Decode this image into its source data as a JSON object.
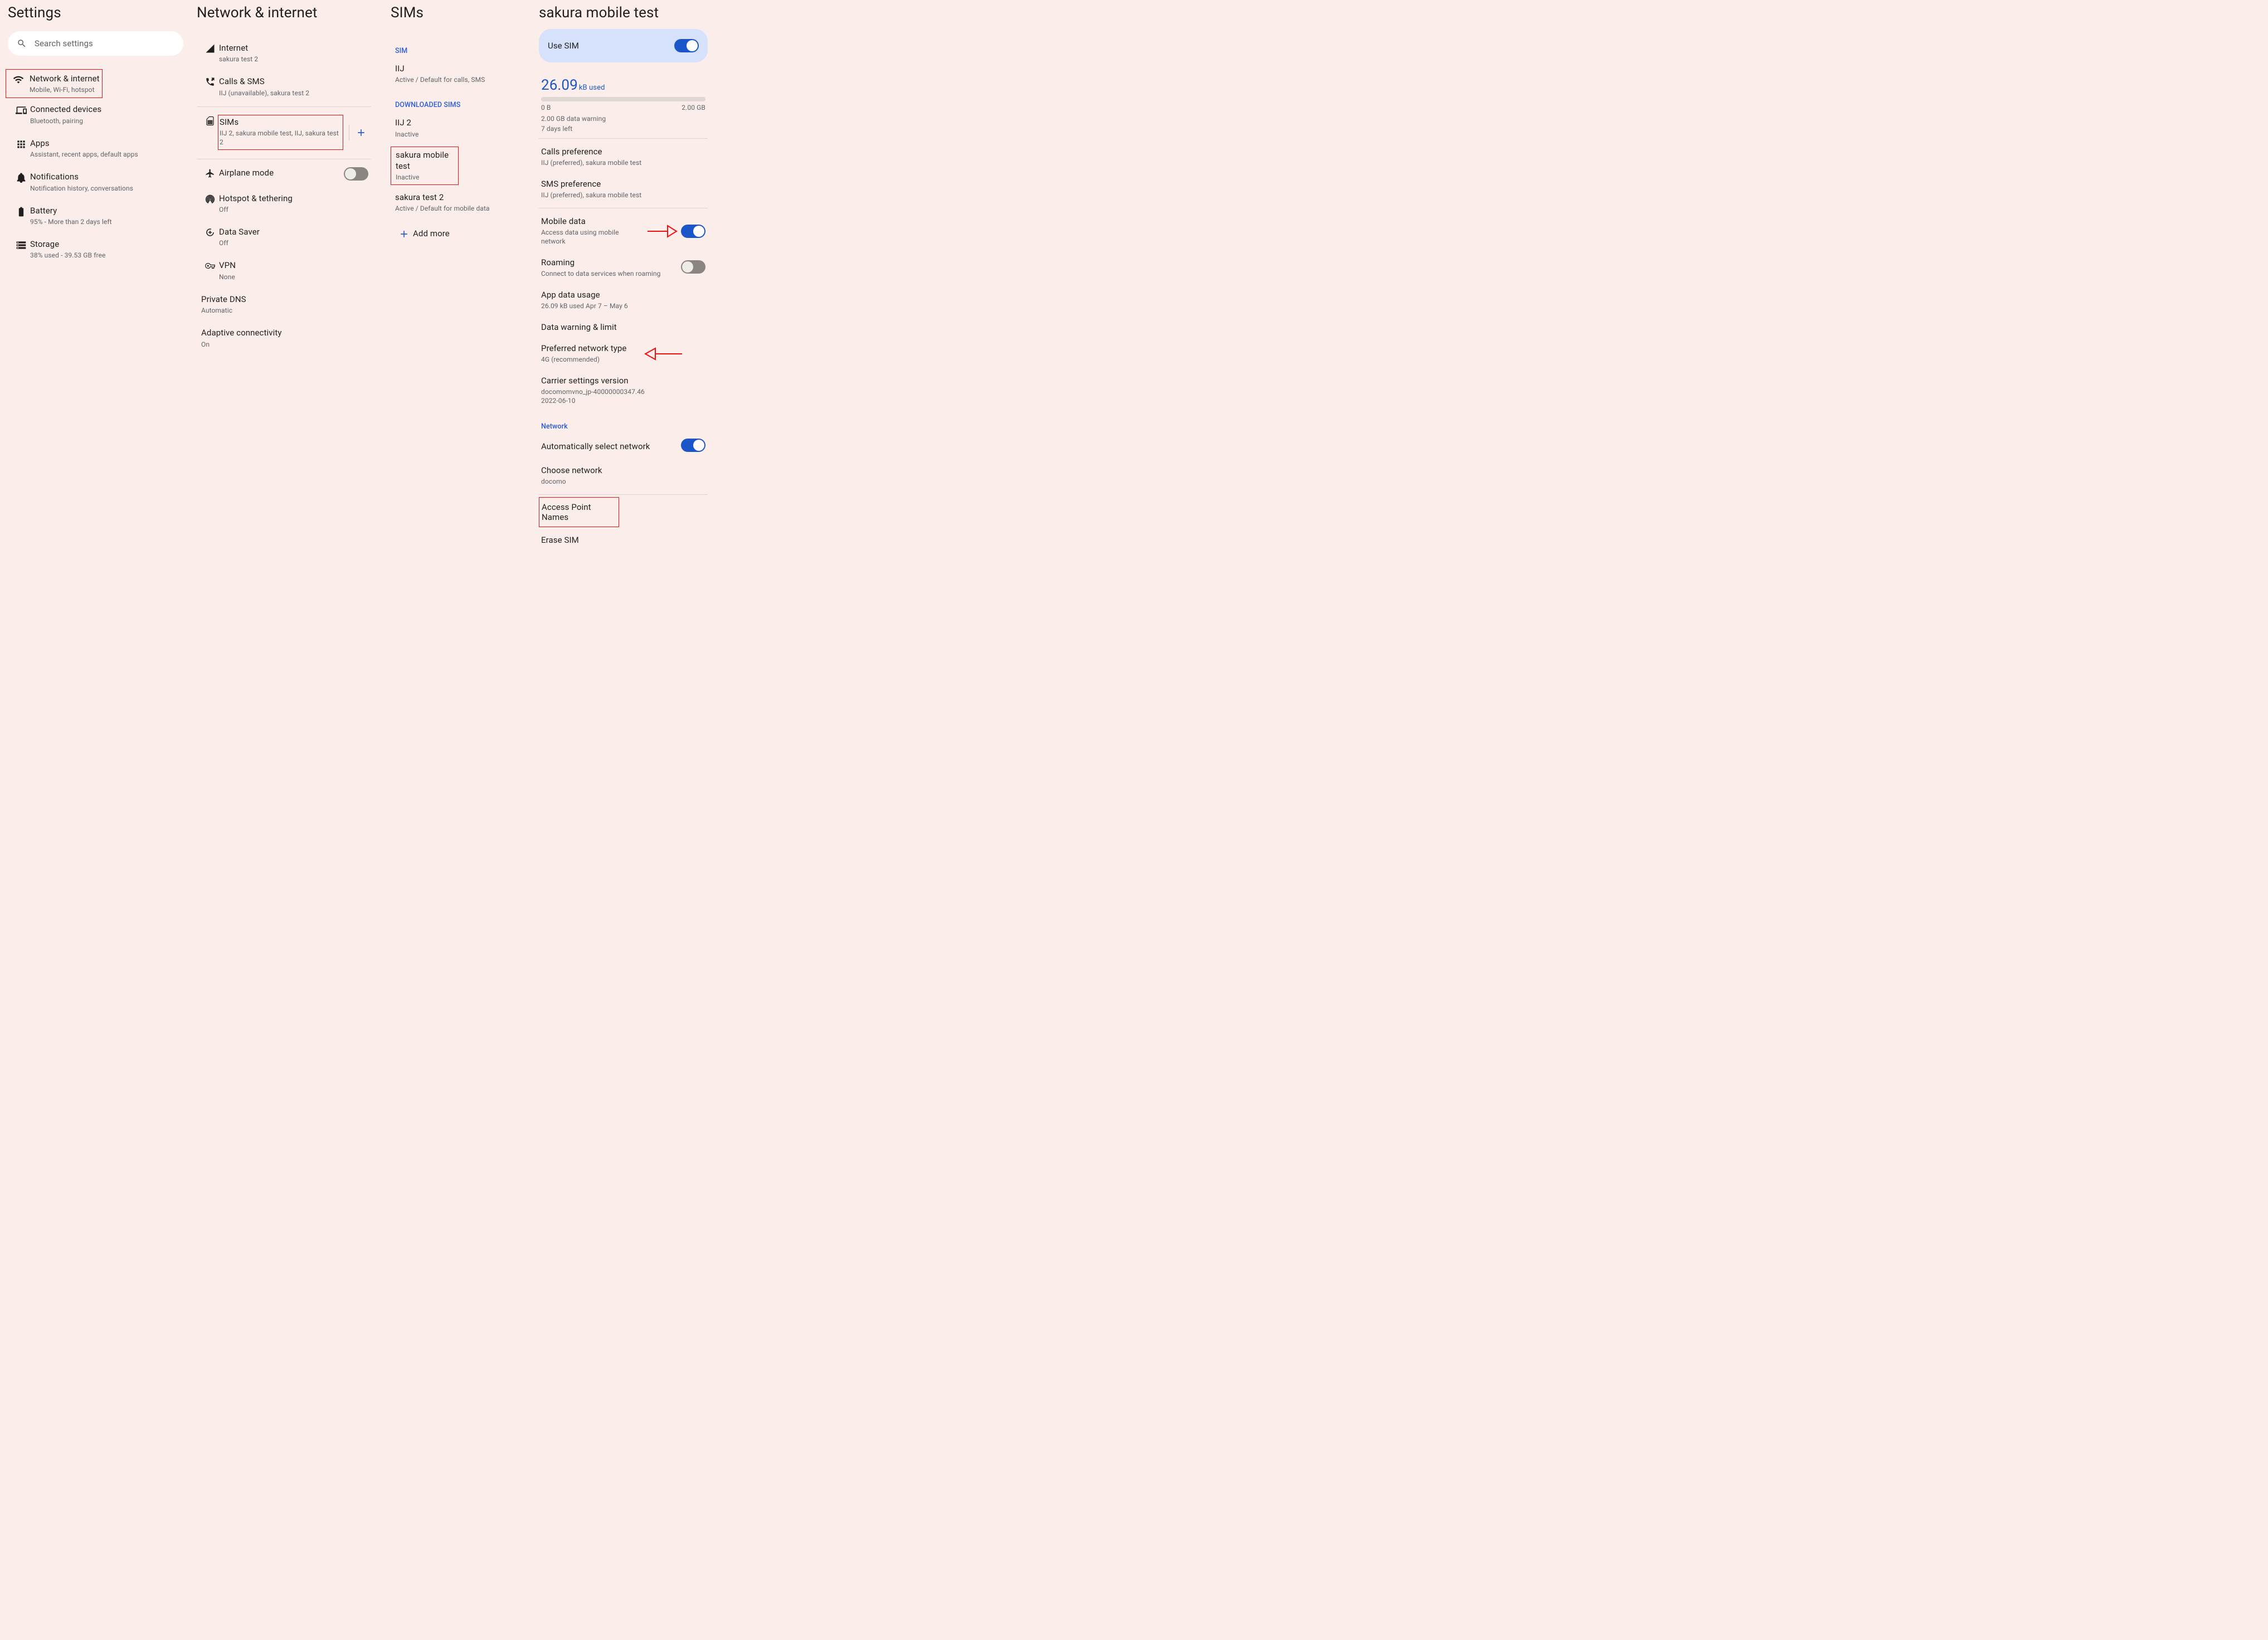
{
  "col1": {
    "title": "Settings",
    "search_placeholder": "Search settings",
    "items": [
      {
        "title": "Network & internet",
        "sub": "Mobile, Wi-Fi, hotspot"
      },
      {
        "title": "Connected devices",
        "sub": "Bluetooth, pairing"
      },
      {
        "title": "Apps",
        "sub": "Assistant, recent apps, default apps"
      },
      {
        "title": "Notifications",
        "sub": "Notification history, conversations"
      },
      {
        "title": "Battery",
        "sub": "95% - More than 2 days left"
      },
      {
        "title": "Storage",
        "sub": "38% used - 39.53 GB free"
      }
    ]
  },
  "col2": {
    "title": "Network & internet",
    "items": [
      {
        "title": "Internet",
        "sub": "sakura test 2"
      },
      {
        "title": "Calls & SMS",
        "sub": "IIJ (unavailable), sakura test 2"
      },
      {
        "title": "SIMs",
        "sub": "IIJ 2, sakura mobile test, IIJ, sakura test 2"
      },
      {
        "title": "Airplane mode",
        "sub": ""
      },
      {
        "title": "Hotspot & tethering",
        "sub": "Off"
      },
      {
        "title": "Data Saver",
        "sub": "Off"
      },
      {
        "title": "VPN",
        "sub": "None"
      },
      {
        "title": "Private DNS",
        "sub": "Automatic"
      },
      {
        "title": "Adaptive connectivity",
        "sub": "On"
      }
    ]
  },
  "col3": {
    "title": "SIMs",
    "sec1": "SIM",
    "sims1": [
      {
        "title": "IIJ",
        "sub": "Active / Default for calls, SMS"
      }
    ],
    "sec2": "DOWNLOADED SIMS",
    "sims2": [
      {
        "title": "IIJ 2",
        "sub": "Inactive"
      },
      {
        "title": "sakura mobile test",
        "sub": "Inactive"
      },
      {
        "title": "sakura test 2",
        "sub": "Active / Default for mobile data"
      }
    ],
    "add_more": "Add more"
  },
  "col4": {
    "title": "sakura mobile test",
    "use_sim": "Use SIM",
    "usage_value": "26.09",
    "usage_unit": "kB used",
    "cap_left": "0 B",
    "cap_right": "2.00 GB",
    "warn_line": "2.00 GB data warning",
    "days_line": "7 days left",
    "calls_pref": {
      "title": "Calls preference",
      "sub": "IIJ (preferred), sakura mobile test"
    },
    "sms_pref": {
      "title": "SMS preference",
      "sub": "IIJ (preferred), sakura mobile test"
    },
    "mobile_data": {
      "title": "Mobile data",
      "sub": "Access data using mobile network"
    },
    "roaming": {
      "title": "Roaming",
      "sub": "Connect to data services when roaming"
    },
    "app_usage": {
      "title": "App data usage",
      "sub": "26.09 kB used Apr 7 – May 6"
    },
    "data_warning": {
      "title": "Data warning & limit"
    },
    "pref_net": {
      "title": "Preferred network type",
      "sub": "4G (recommended)"
    },
    "carrier": {
      "title": "Carrier settings version",
      "sub": "docomomvno_jp-40000000347.46\n2022-06-10"
    },
    "network_section": "Network",
    "auto_net": {
      "title": "Automatically select network"
    },
    "choose_net": {
      "title": "Choose network",
      "sub": "docomo"
    },
    "apn": {
      "title": "Access Point Names"
    },
    "erase": {
      "title": "Erase SIM"
    }
  }
}
